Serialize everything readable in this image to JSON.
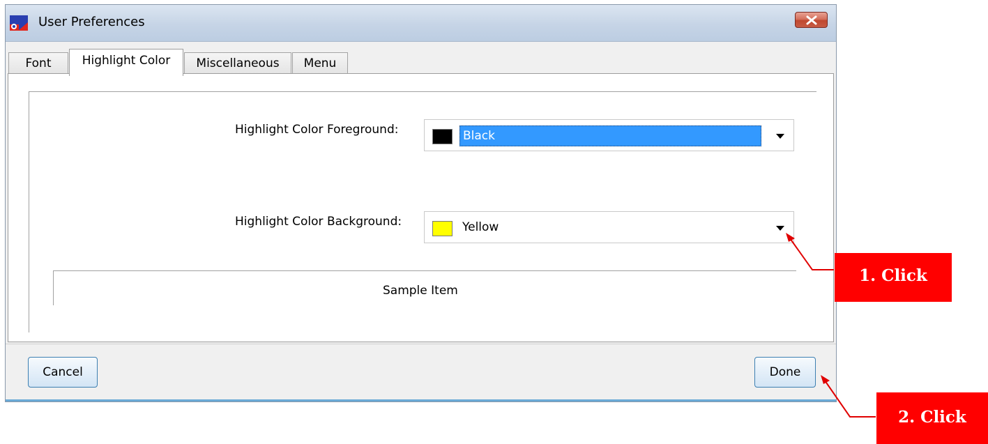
{
  "window": {
    "title": "User Preferences",
    "close_label": "×"
  },
  "tabs": [
    {
      "label": "Font",
      "active": false
    },
    {
      "label": "Highlight Color",
      "active": true
    },
    {
      "label": "Miscellaneous",
      "active": false
    },
    {
      "label": "Menu",
      "active": false
    }
  ],
  "highlight": {
    "foreground_label": "Highlight Color Foreground:",
    "foreground_value": "Black",
    "foreground_color": "#000000",
    "background_label": "Highlight Color Background:",
    "background_value": "Yellow",
    "background_color": "#ffff00",
    "sample_text": "Sample Item"
  },
  "buttons": {
    "cancel_label": "Cancel",
    "done_label": "Done"
  },
  "annotations": {
    "step1": "1. Click",
    "step2": "2. Click",
    "color": "#ff0000"
  }
}
